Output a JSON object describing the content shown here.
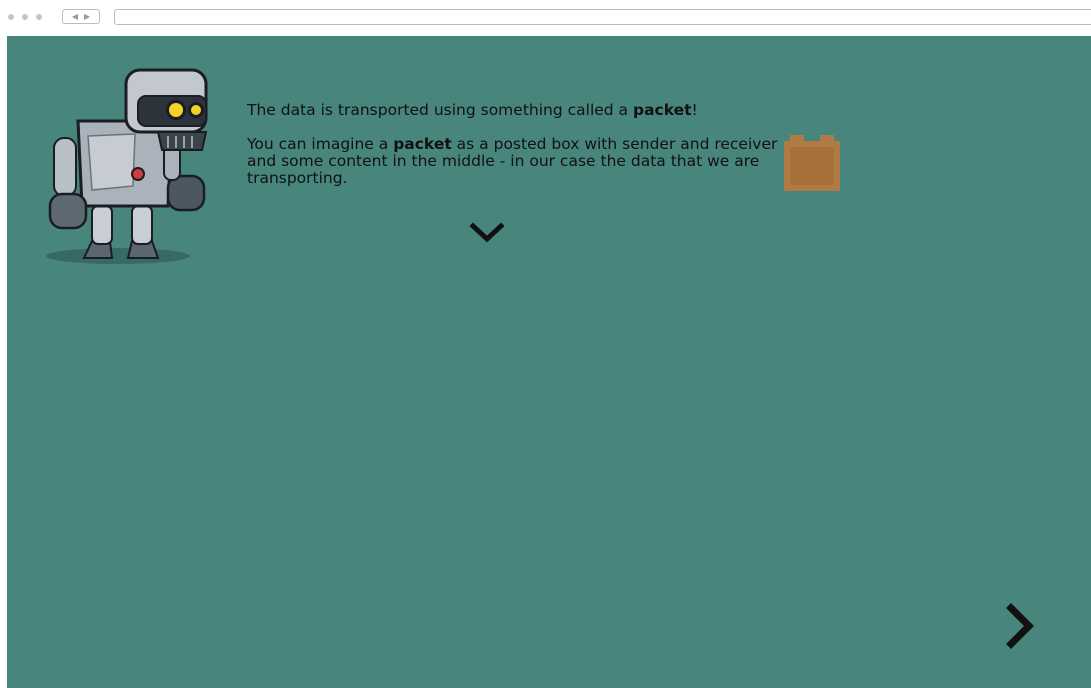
{
  "slide": {
    "line1_prefix": "The data is transported using something called a ",
    "line1_bold": "packet",
    "line1_suffix": "!",
    "line2_prefix": "You can imagine a ",
    "line2_bold": "packet",
    "line2_rest_a": " as a posted box with sender and receiver",
    "line2_rest_b": "and some content in the middle - in our case the data that we are",
    "line2_rest_c": "transporting."
  },
  "icons": {
    "robot": "robot-character",
    "packet": "package-box-icon",
    "down": "chevron-down-icon",
    "next": "chevron-right-icon"
  },
  "colors": {
    "background": "#48857d",
    "text": "#111111",
    "box": "#b07a44"
  }
}
